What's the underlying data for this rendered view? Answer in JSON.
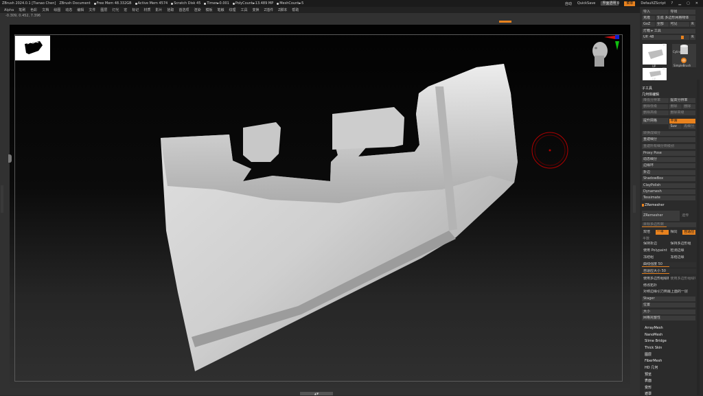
{
  "titlebar": {
    "app": "ZBrush 2024.0.1 [Tianao Chen]",
    "doc": "ZBrush Document",
    "stats": [
      "Free Mem 48.332GB",
      "Active Mem 4574",
      "Scratch Disk 45",
      "Timer►0.001",
      "PolyCount►13.489 MP",
      "MeshCount►5"
    ],
    "autosave": "自动",
    "quicksave": "QuickSave",
    "transparency": "界面透明 0",
    "menu_btn": "菜单",
    "script": "DefaultZScript"
  },
  "menubar": [
    "Alpha",
    "笔刷",
    "色彩",
    "文档",
    "绘图",
    "动态",
    "编辑",
    "文件",
    "图层",
    "灯光",
    "宏",
    "标记",
    "材质",
    "影片",
    "拾取",
    "首选项",
    "渲染",
    "模板",
    "笔触",
    "纹理",
    "工具",
    "变换",
    "Z插件",
    "Z脚本",
    "帮助"
  ],
  "coords": "-0.309, 0.452, 7.396",
  "panel": {
    "top": {
      "row1": [
        "导入",
        "导出"
      ],
      "row2": [
        "克隆",
        "生成 多边形网格物体"
      ],
      "row3": [
        "GoZ",
        "全部",
        "可见",
        "R"
      ],
      "row4": [
        "灯箱 ▸ 工具"
      ],
      "up": {
        "label": "UP.",
        "value": "48",
        "r": "R"
      }
    },
    "subtools": {
      "count1": "11",
      "label1": "UP",
      "cyl": "Cylinder3D",
      "simple": "SimpleBrush",
      "count2": "21",
      "label2": "UP"
    },
    "subtool_title": "子工具",
    "geometry_title": "几何体编辑",
    "geo": {
      "r1": [
        "降低分辨率",
        "提高分辨率"
      ],
      "r2": [
        "删除低级",
        "删除",
        "删除"
      ],
      "r3": [
        "删除高级",
        "删除高级"
      ],
      "r4a": "提升网格",
      "r4b": "平滑",
      "r5": [
        "Suv",
        "再细分"
      ],
      "r6": "转换成细分",
      "r7": "重建细分",
      "r8": "重建所有细分到级别"
    },
    "list1": [
      "Proxy Pose",
      "动态细分",
      "边缘环",
      "折边",
      "ShadowBox",
      "ClayPolish",
      "Dynamesh",
      "Tessimate"
    ],
    "zremesher_title": "ZRemesher",
    "zremesher_btn": "ZRemesher",
    "zremesher_lbl": "遗传",
    "target": "目标多边形数",
    "target_sub": "半数",
    "density": [
      "双倍",
      "一半",
      "相同",
      "自适应"
    ],
    "adapt_size": "自适应尺寸",
    "rows": [
      [
        "保持折边",
        "保持多边形组"
      ],
      [
        "使用 Polypaint",
        "检测边缘"
      ],
      [
        "冻结组",
        "冻结边缘"
      ]
    ],
    "curve_strength": "曲线强度 50",
    "curve_size": "自适应大小 50",
    "opts": [
      [
        "使用多边形组绘制",
        "使用多边形组绘制"
      ],
      [
        "修改拓扑"
      ],
      [
        "对称边缘引力到最上面的一层"
      ],
      [
        "Stager"
      ],
      [
        "位置"
      ],
      [
        "大小"
      ],
      [
        "网格完整性"
      ]
    ],
    "extras": [
      "ArrayMesh",
      "NanoMesh",
      "Slime Bridge",
      "Thick Skin",
      "图层",
      "FiberMesh",
      "HD 几何",
      "预览",
      "表面",
      "变形",
      "遮罩"
    ]
  },
  "colors": {
    "accent": "#e8821e",
    "cursor_ring": "#b00000",
    "gizmo_red": "#d01010",
    "gizmo_green": "#10c010",
    "gizmo_blue": "#1020d0"
  },
  "icons": [
    "camera-head-icon",
    "axis-gizmo-icon",
    "brush-cursor-icon",
    "simplebrush-icon",
    "cylinder-icon"
  ]
}
